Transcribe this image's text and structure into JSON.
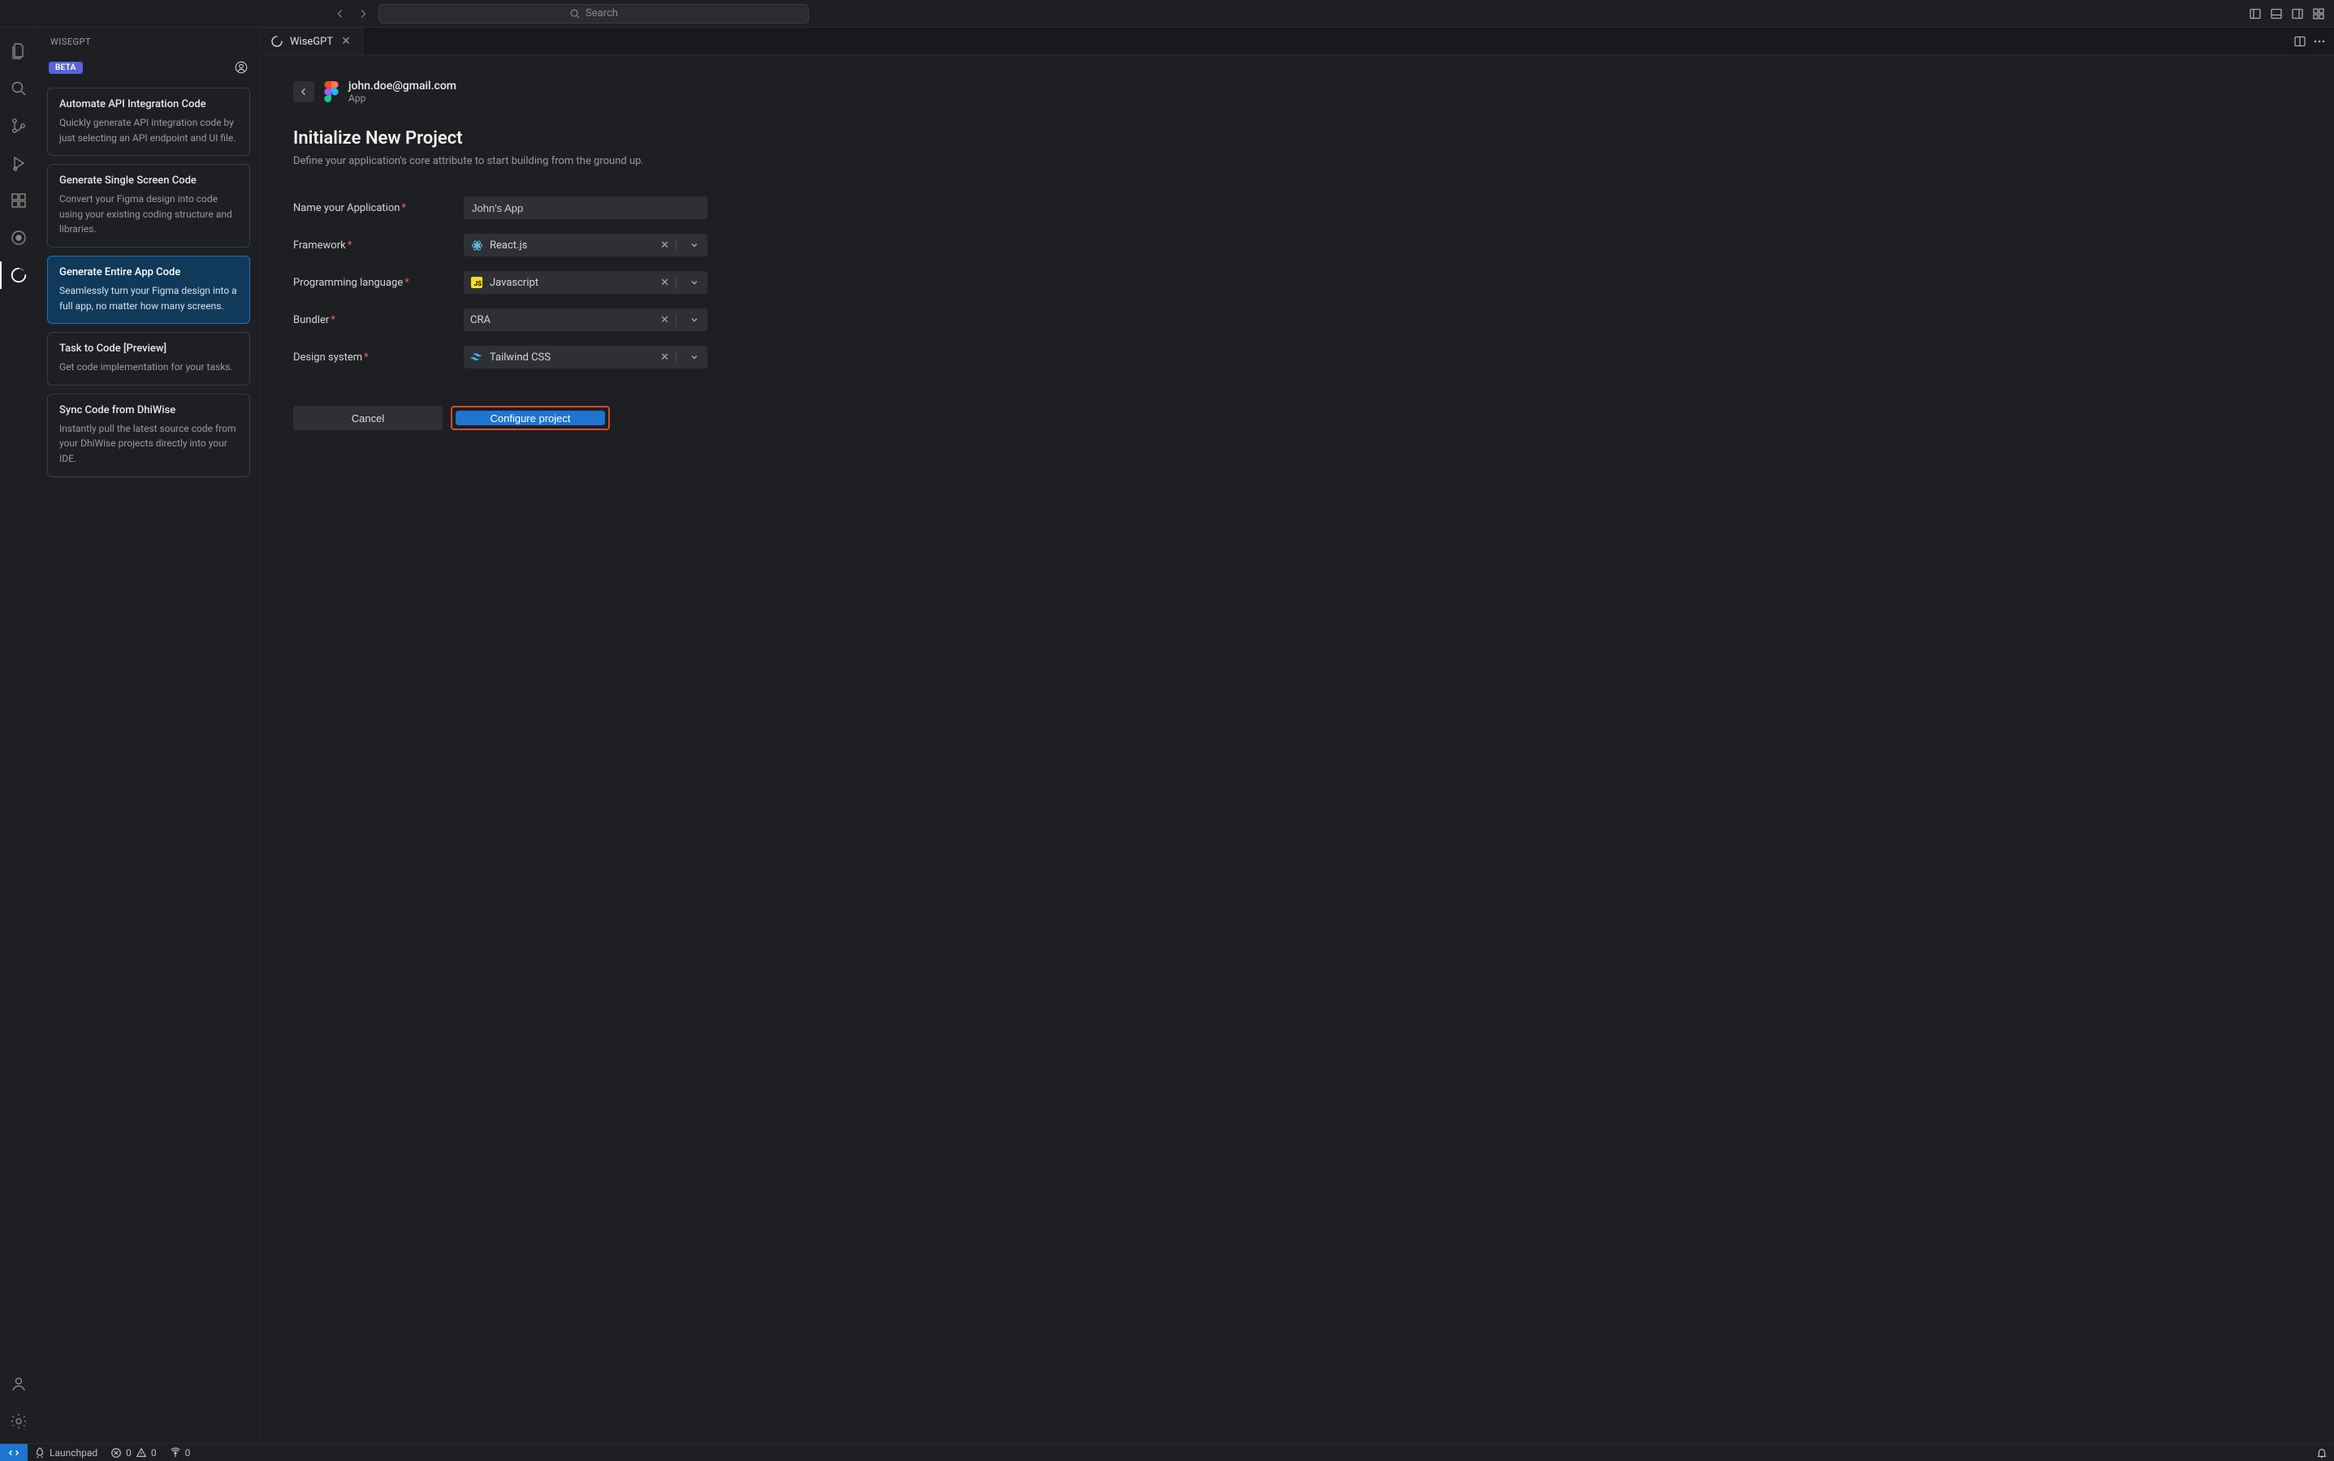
{
  "titlebar": {
    "search_placeholder": "Search"
  },
  "sidebar": {
    "title": "WISEGPT",
    "beta_label": "BETA",
    "cards": [
      {
        "title": "Automate API Integration Code",
        "desc": "Quickly generate API integration code by just selecting an API endpoint and UI file."
      },
      {
        "title": "Generate Single Screen Code",
        "desc": "Convert your Figma design into code using your existing coding structure and libraries."
      },
      {
        "title": "Generate Entire App Code",
        "desc": "Seamlessly turn your Figma design into a full app, no matter how many screens."
      },
      {
        "title": "Task to Code [Preview]",
        "desc": "Get code implementation for your tasks."
      },
      {
        "title": "Sync Code from DhiWise",
        "desc": "Instantly pull the latest source code from your DhiWise projects directly into your IDE."
      }
    ]
  },
  "tab": {
    "label": "WiseGPT"
  },
  "page": {
    "email": "john.doe@gmail.com",
    "email_sub": "App",
    "title": "Initialize New Project",
    "subtitle": "Define your application's core attribute to start building from the ground up."
  },
  "form": {
    "name_label": "Name your Application",
    "name_value": "John's App",
    "framework_label": "Framework",
    "framework_value": "React.js",
    "lang_label": "Programming language",
    "lang_value": "Javascript",
    "bundler_label": "Bundler",
    "bundler_value": "CRA",
    "design_label": "Design system",
    "design_value": "Tailwind CSS",
    "cancel_label": "Cancel",
    "submit_label": "Configure project"
  },
  "statusbar": {
    "launchpad": "Launchpad",
    "errors": "0",
    "warnings": "0",
    "ports": "0"
  }
}
